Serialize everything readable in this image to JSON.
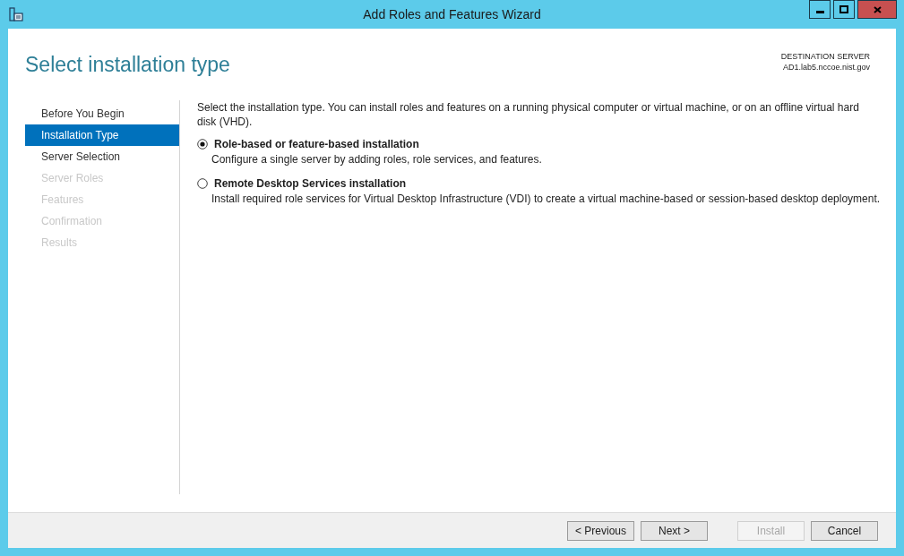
{
  "window": {
    "title": "Add Roles and Features Wizard"
  },
  "header": {
    "title": "Select installation type",
    "destination_label": "DESTINATION SERVER",
    "destination_server": "AD1.lab5.nccoe.nist.gov"
  },
  "sidebar": {
    "items": [
      {
        "label": "Before You Begin",
        "selected": false,
        "disabled": false
      },
      {
        "label": "Installation Type",
        "selected": true,
        "disabled": false
      },
      {
        "label": "Server Selection",
        "selected": false,
        "disabled": false
      },
      {
        "label": "Server Roles",
        "selected": false,
        "disabled": true
      },
      {
        "label": "Features",
        "selected": false,
        "disabled": true
      },
      {
        "label": "Confirmation",
        "selected": false,
        "disabled": true
      },
      {
        "label": "Results",
        "selected": false,
        "disabled": true
      }
    ]
  },
  "content": {
    "intro": "Select the installation type. You can install roles and features on a running physical computer or virtual machine, or on an offline virtual hard disk (VHD).",
    "options": [
      {
        "label": "Role-based or feature-based installation",
        "description": "Configure a single server by adding roles, role services, and features.",
        "selected": true
      },
      {
        "label": "Remote Desktop Services installation",
        "description": "Install required role services for Virtual Desktop Infrastructure (VDI) to create a virtual machine-based or session-based desktop deployment.",
        "selected": false
      }
    ]
  },
  "buttons": [
    {
      "label": "< Previous",
      "disabled": false
    },
    {
      "label": "Next >",
      "disabled": false
    },
    {
      "label": "Install",
      "disabled": true
    },
    {
      "label": "Cancel",
      "disabled": false
    }
  ]
}
